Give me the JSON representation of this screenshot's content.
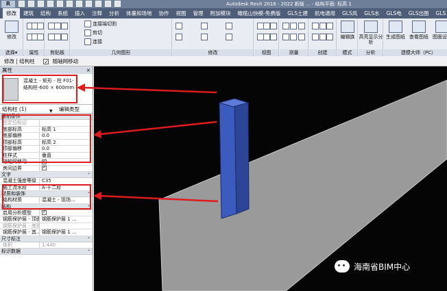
{
  "titlebar": {
    "logo": "R",
    "title": "Autodesk Revit 2016 - 2022 新版 ... - 结构平面: 标高 1"
  },
  "tabs": [
    "建筑",
    "结构",
    "系统",
    "插入",
    "注释",
    "分析",
    "体量和场地",
    "协作",
    "视图",
    "管理",
    "附加模块",
    "橄榄山快模-免费版",
    "GLS土建",
    "机电通用",
    "GLS风",
    "GLS水",
    "GLS电",
    "GLS出图",
    "GLS"
  ],
  "active_tab": "修改",
  "ribbon": {
    "groups": [
      {
        "label": "选择▾",
        "buttons": [
          "修改"
        ]
      },
      {
        "label": "属性",
        "buttons": []
      },
      {
        "label": "剪贴板",
        "buttons": []
      },
      {
        "label": "几何图形",
        "buttons": [
          "连接端切割",
          "剪切",
          "连接"
        ]
      },
      {
        "label": "修改",
        "buttons": []
      },
      {
        "label": "视图",
        "buttons": []
      },
      {
        "label": "测量",
        "buttons": []
      },
      {
        "label": "创建",
        "buttons": []
      },
      {
        "label": "模式",
        "buttons": [
          "编辑族"
        ]
      },
      {
        "label": "分析",
        "buttons": [
          "高亮显示分析"
        ]
      },
      {
        "label": "建模大师（PC）",
        "buttons": [
          "生成图纸",
          "查看图纸",
          "图面设置"
        ]
      }
    ]
  },
  "optbar": {
    "context": "修改 | 结构柱",
    "checkbox_label": "随轴网移动"
  },
  "properties": {
    "header": "属性",
    "close": "×",
    "type_name": "混凝土 - 矩形 - 柱 F01-结构柱-600 × 600mm",
    "instance_selector": "结构柱 (1)",
    "edit_type": "编辑类型",
    "sections": [
      {
        "title": "限制条件",
        "rows": [
          {
            "k": "柱定位标记",
            "v": "",
            "dim": true
          },
          {
            "k": "底部标高",
            "v": "标高 1"
          },
          {
            "k": "底部偏移",
            "v": "0.0"
          },
          {
            "k": "顶部标高",
            "v": "标高 2"
          },
          {
            "k": "顶部偏移",
            "v": "0.0"
          },
          {
            "k": "柱样式",
            "v": "垂直"
          },
          {
            "k": "随轴网移动",
            "v": "",
            "checkbox": true
          },
          {
            "k": "房间边界",
            "v": "",
            "checkbox": true
          }
        ]
      },
      {
        "title": "文字",
        "rows": [
          {
            "k": "混凝土强度等级",
            "v": "C35"
          },
          {
            "k": "施工流水段",
            "v": "A-十二段"
          }
        ]
      },
      {
        "title": "材质和装饰",
        "rows": [
          {
            "k": "结构材质",
            "v": "混凝土 - 现场..."
          }
        ]
      },
      {
        "title": "结构",
        "rows": [
          {
            "k": "启用分析模型",
            "v": "",
            "checkbox": true
          },
          {
            "k": "钢筋保护层 - 顶面",
            "v": "钢筋保护层 1 ..."
          },
          {
            "k": "钢筋保护层 - 底面",
            "v": "",
            "dim": true
          },
          {
            "k": "钢筋保护层 - 其...",
            "v": "钢筋保护层 1 ..."
          }
        ]
      },
      {
        "title": "尺寸标注",
        "rows": [
          {
            "k": "体积",
            "v": "1.440",
            "dim": true
          }
        ]
      },
      {
        "title": "标识数据",
        "rows": []
      }
    ]
  },
  "watermark": "海南省BIM中心",
  "colors": {
    "highlight": "#e01b1b",
    "column": "#3b5bbf",
    "slab": "#9a9a9a",
    "viewport_bg": "#050505"
  }
}
